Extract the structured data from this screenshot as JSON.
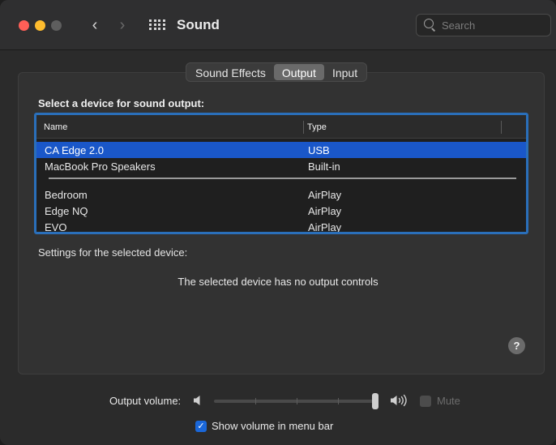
{
  "window": {
    "title": "Sound",
    "search_placeholder": "Search"
  },
  "tabs": [
    {
      "label": "Sound Effects",
      "active": false
    },
    {
      "label": "Output",
      "active": true
    },
    {
      "label": "Input",
      "active": false
    }
  ],
  "output": {
    "heading": "Select a device for sound output:",
    "columns": {
      "name": "Name",
      "type": "Type"
    },
    "devices": [
      {
        "name": "CA Edge 2.0",
        "type": "USB",
        "selected": true
      },
      {
        "name": "MacBook Pro Speakers",
        "type": "Built-in",
        "selected": false
      },
      {
        "name": "Bedroom",
        "type": "AirPlay",
        "selected": false
      },
      {
        "name": "Edge NQ",
        "type": "AirPlay",
        "selected": false
      },
      {
        "name": "EVO",
        "type": "AirPlay",
        "selected": false
      }
    ],
    "settings_label": "Settings for the selected device:",
    "no_controls_message": "The selected device has no output controls",
    "help_label": "?"
  },
  "volume": {
    "label": "Output volume:",
    "level": 1.0,
    "mute_label": "Mute",
    "mute_checked": false,
    "show_in_menu_bar_label": "Show volume in menu bar",
    "show_in_menu_bar_checked": true
  },
  "colors": {
    "selection": "#1a57c9",
    "table_focus_ring": "#2a6fba",
    "checkbox_checked": "#1a67d9"
  },
  "icons": {
    "back": "chevron-left-icon",
    "forward": "chevron-right-icon",
    "show_all": "grid-icon",
    "search": "search-icon",
    "volume_low": "speaker-low-icon",
    "volume_high": "speaker-high-icon",
    "checkmark": "checkmark-icon"
  }
}
